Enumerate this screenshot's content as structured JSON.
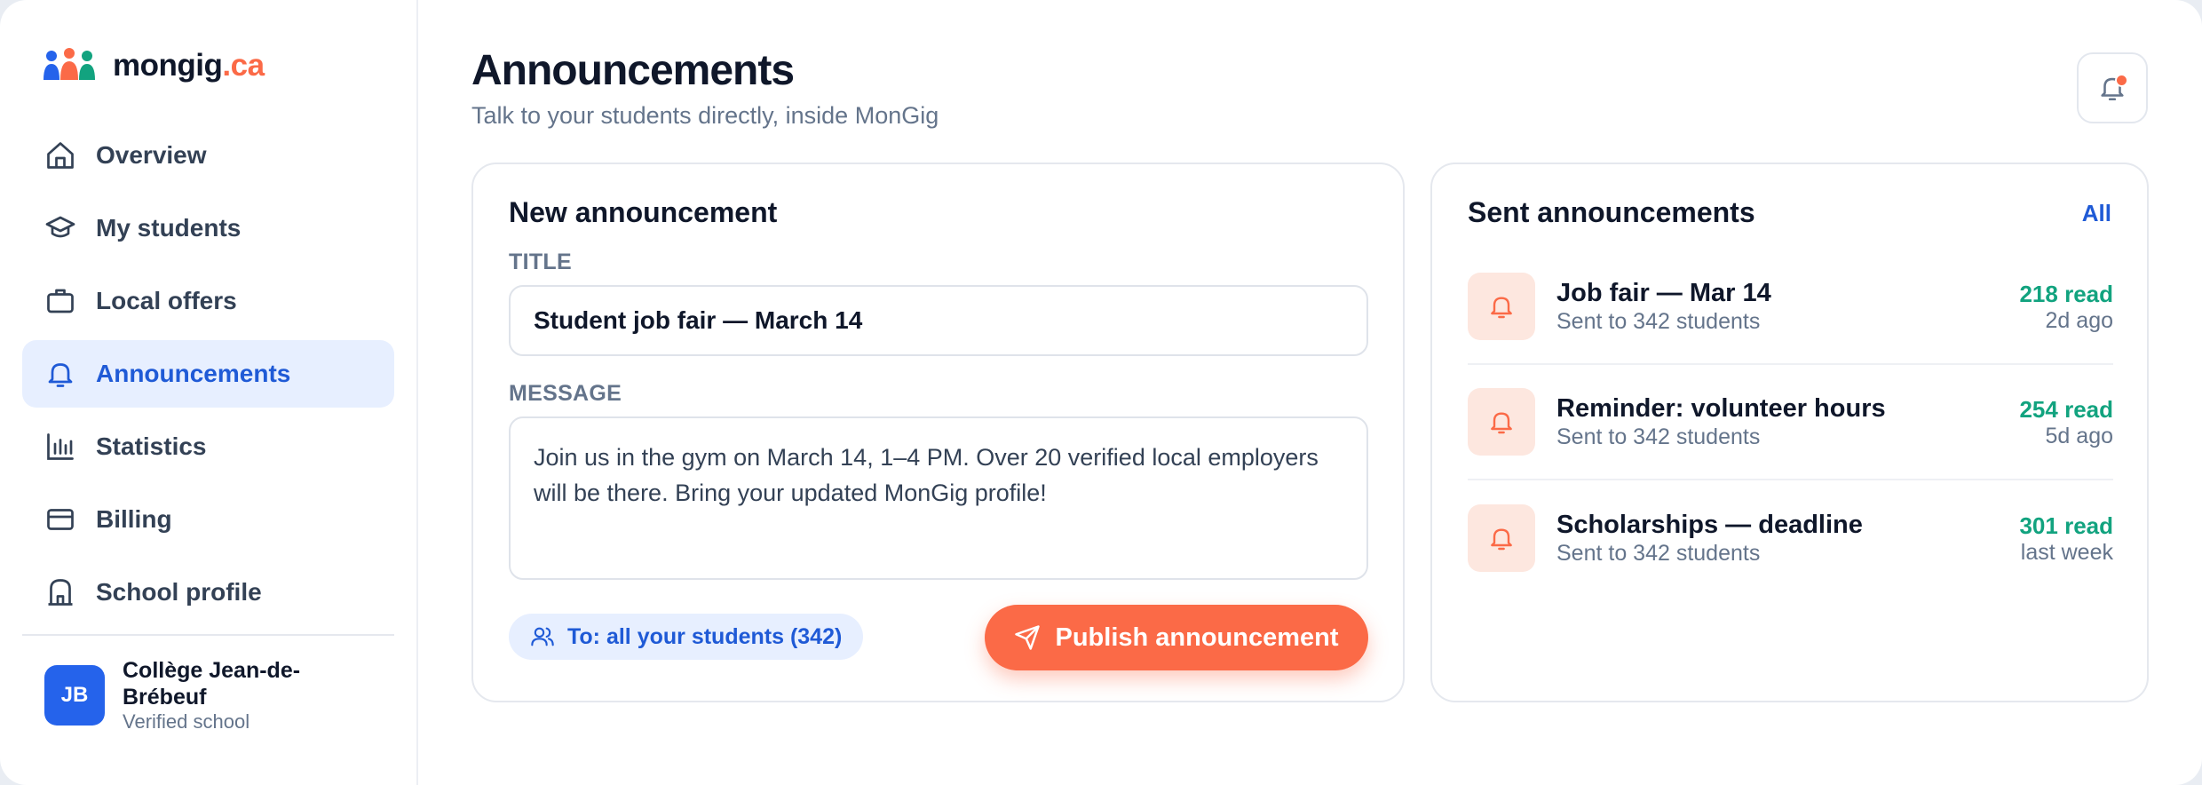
{
  "brand": {
    "name": "mongig",
    "tld": ".ca",
    "accent": "#fb6a47",
    "primary": "#2563eb"
  },
  "sidebar": {
    "items": [
      {
        "label": "Overview",
        "icon": "home-icon",
        "active": false
      },
      {
        "label": "My students",
        "icon": "graduation-cap-icon",
        "active": false
      },
      {
        "label": "Local offers",
        "icon": "briefcase-icon",
        "active": false
      },
      {
        "label": "Announcements",
        "icon": "bell-icon",
        "active": true
      },
      {
        "label": "Statistics",
        "icon": "bar-chart-icon",
        "active": false
      },
      {
        "label": "Billing",
        "icon": "credit-card-icon",
        "active": false
      },
      {
        "label": "School profile",
        "icon": "school-building-icon",
        "active": false
      }
    ],
    "school": {
      "initials": "JB",
      "name": "Collège Jean-de-Brébeuf",
      "status": "Verified school"
    }
  },
  "header": {
    "title": "Announcements",
    "subtitle": "Talk to your students directly, inside MonGig",
    "notification_icon": "bell-icon",
    "has_unread": true
  },
  "composer": {
    "heading": "New announcement",
    "title_label": "TITLE",
    "title_value": "Student job fair — March 14",
    "message_label": "MESSAGE",
    "message_value": "Join us in the gym on March 14, 1–4 PM. Over 20 verified local employers will be there. Bring your updated MonGig profile!",
    "audience": "To: all your students (342)",
    "publish_label": "Publish announcement"
  },
  "sent": {
    "heading": "Sent announcements",
    "all_label": "All",
    "items": [
      {
        "title": "Job fair — Mar 14",
        "recipients": "Sent to 342 students",
        "reads": "218 read",
        "ago": "2d ago"
      },
      {
        "title": "Reminder: volunteer hours",
        "recipients": "Sent to 342 students",
        "reads": "254 read",
        "ago": "5d ago"
      },
      {
        "title": "Scholarships — deadline",
        "recipients": "Sent to 342 students",
        "reads": "301 read",
        "ago": "last week"
      }
    ]
  }
}
